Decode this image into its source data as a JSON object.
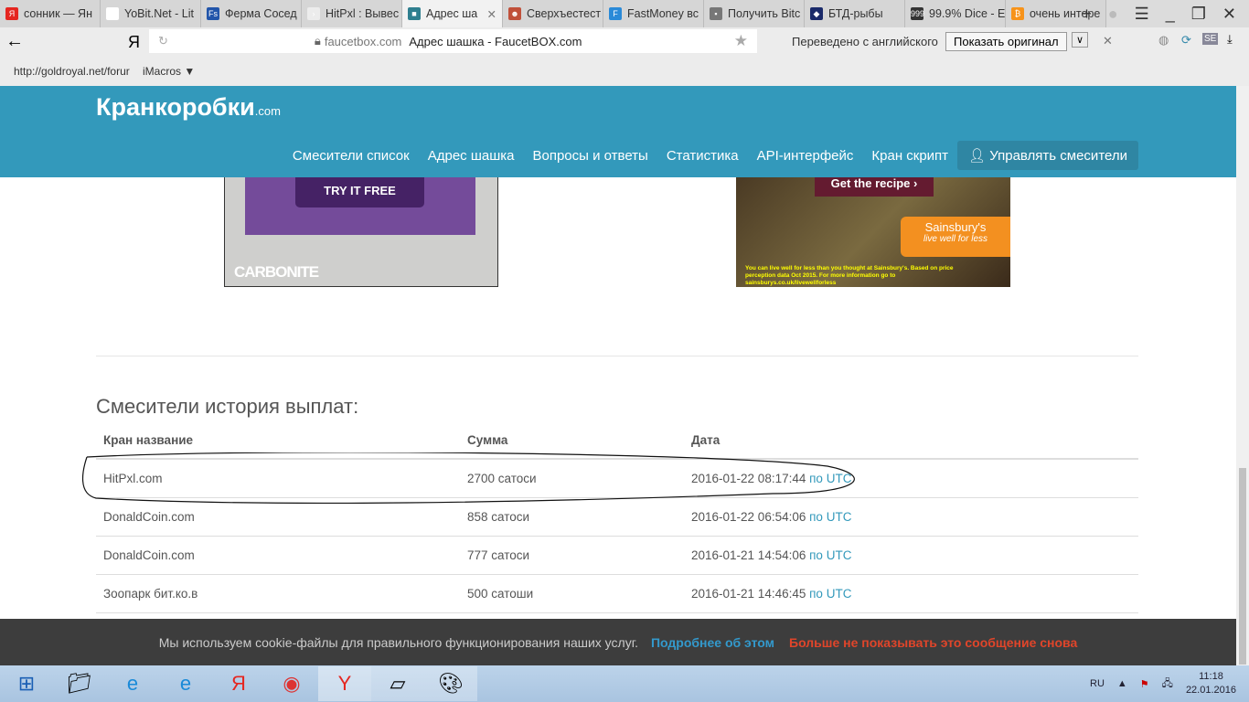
{
  "browser": {
    "tabs": [
      {
        "label": "сонник — Ян",
        "color": "#e52620",
        "glyph": "Я"
      },
      {
        "label": "YoBit.Net - Lit",
        "color": "#ffffff",
        "glyph": "▯"
      },
      {
        "label": "Ферма Сосед",
        "color": "#2255aa",
        "glyph": "Fs"
      },
      {
        "label": "HitPxl : Вывес",
        "color": "#ececec",
        "glyph": "›"
      },
      {
        "label": "Адрес ша",
        "color": "#2f7f8f",
        "glyph": "■",
        "active": true
      },
      {
        "label": "Сверхъестест",
        "color": "#c0503a",
        "glyph": "☻"
      },
      {
        "label": "FastMoney вс",
        "color": "#2a8ad8",
        "glyph": "F"
      },
      {
        "label": "Получить Bitc",
        "color": "#777777",
        "glyph": "▪"
      },
      {
        "label": "БТД-рыбы",
        "color": "#1a2a6a",
        "glyph": "◆"
      },
      {
        "label": "99.9% Dice - E",
        "color": "#333333",
        "glyph": "999"
      },
      {
        "label": "очень интере",
        "color": "#f7931a",
        "glyph": "₿"
      }
    ],
    "new_tab": "+",
    "domain": "faucetbox.com",
    "page_title": "Адрес шашка - FaucetBOX.com",
    "translate_text": "Переведено с английского",
    "show_original": "Показать оригинал",
    "yandex_glyph": "Я",
    "bookmarks": [
      "http://goldroyal.net/forur",
      "iMacros ▼"
    ]
  },
  "site": {
    "logo": "Кранкоробки",
    "logo_suffix": ".com",
    "nav": [
      "Смесители список",
      "Адрес шашка",
      "Вопросы и ответы",
      "Статистика",
      "API-интерфейс",
      "Кран скрипт"
    ],
    "manage": "Управлять смесители"
  },
  "ads": {
    "left": {
      "button": "TRY IT FREE",
      "brand": "CARBONITE"
    },
    "right": {
      "button": "Get the recipe",
      "brand": "Sainsbury's",
      "tagline": "live well for less",
      "fine": "You can live well for less than you thought at Sainsbury's. Based on price perception data Oct 2015. For more information go to sainsburys.co.uk/livewellforless"
    }
  },
  "history": {
    "title": "Смесители история выплат:",
    "columns": [
      "Кран название",
      "Сумма",
      "Дата"
    ],
    "rows": [
      {
        "name": "HitPxl.com",
        "amount": "2700 сатоси",
        "date": "2016-01-22 08:17:44",
        "tz": "по UTC"
      },
      {
        "name": "DonaldCoin.com",
        "amount": "858 сатоси",
        "date": "2016-01-22 06:54:06",
        "tz": "по UTC"
      },
      {
        "name": "DonaldCoin.com",
        "amount": "777 сатоси",
        "date": "2016-01-21 14:54:06",
        "tz": "по UTC"
      },
      {
        "name": "Зоопарк бит.ко.в",
        "amount": "500 сатоши",
        "date": "2016-01-21 14:46:45",
        "tz": "по UTC"
      }
    ]
  },
  "cookie": {
    "text": "Мы используем cookie-файлы для правильного функционирования наших услуг.",
    "more": "Подробнее об этом",
    "dismiss": "Больше не показывать это сообщение снова"
  },
  "taskbar": {
    "lang": "RU",
    "time": "11:18",
    "date": "22.01.2016"
  }
}
